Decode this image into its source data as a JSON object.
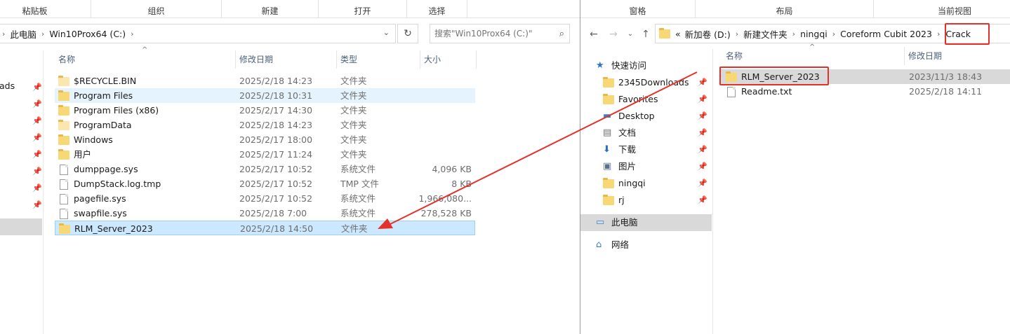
{
  "left": {
    "ribbon": [
      "粘贴板",
      "组织",
      "新建",
      "打开",
      "选择"
    ],
    "address": [
      "此电脑",
      "Win10Prox64 (C:)"
    ],
    "search_placeholder": "搜索\"Win10Prox64 (C:)\"",
    "columns": {
      "name": "名称",
      "date": "修改日期",
      "type": "类型",
      "size": "大小"
    },
    "nav_partial": "ads",
    "files": [
      {
        "name": "$RECYCLE.BIN",
        "date": "2025/2/18 14:23",
        "type": "文件夹",
        "size": "",
        "icon": "folder-pale-icon"
      },
      {
        "name": "Program Files",
        "date": "2025/2/18 10:31",
        "type": "文件夹",
        "size": "",
        "icon": "folder-icon"
      },
      {
        "name": "Program Files (x86)",
        "date": "2025/2/17 14:30",
        "type": "文件夹",
        "size": "",
        "icon": "folder-icon"
      },
      {
        "name": "ProgramData",
        "date": "2025/2/18 14:23",
        "type": "文件夹",
        "size": "",
        "icon": "folder-pale-icon"
      },
      {
        "name": "Windows",
        "date": "2025/2/17 18:00",
        "type": "文件夹",
        "size": "",
        "icon": "folder-icon"
      },
      {
        "name": "用户",
        "date": "2025/2/17 11:24",
        "type": "文件夹",
        "size": "",
        "icon": "folder-icon"
      },
      {
        "name": "dumppage.sys",
        "date": "2025/2/17 10:52",
        "type": "系统文件",
        "size": "4,096 KB",
        "icon": "file-icon"
      },
      {
        "name": "DumpStack.log.tmp",
        "date": "2025/2/17 10:52",
        "type": "TMP 文件",
        "size": "8 KB",
        "icon": "file-icon"
      },
      {
        "name": "pagefile.sys",
        "date": "2025/2/17 10:52",
        "type": "系统文件",
        "size": "1,966,080...",
        "icon": "file-icon"
      },
      {
        "name": "swapfile.sys",
        "date": "2025/2/18 7:00",
        "type": "系统文件",
        "size": "278,528 KB",
        "icon": "file-icon"
      },
      {
        "name": "RLM_Server_2023",
        "date": "2025/2/18 14:50",
        "type": "文件夹",
        "size": "",
        "icon": "folder-icon"
      }
    ]
  },
  "right": {
    "ribbon": [
      "窗格",
      "布局",
      "当前视图"
    ],
    "address": [
      "«",
      "新加卷 (D:)",
      "新建文件夹",
      "ningqi",
      "Coreform Cubit 2023",
      "Crack"
    ],
    "columns": {
      "name": "名称",
      "date": "修改日期"
    },
    "nav": [
      {
        "label": "快速访问",
        "icon": "star-icon"
      },
      {
        "label": "2345Downloads",
        "icon": "folder-icon"
      },
      {
        "label": "Favorites",
        "icon": "folder-icon"
      },
      {
        "label": "Desktop",
        "icon": "desktop-icon"
      },
      {
        "label": "文档",
        "icon": "document-icon"
      },
      {
        "label": "下载",
        "icon": "download-icon"
      },
      {
        "label": "图片",
        "icon": "picture-icon"
      },
      {
        "label": "ningqi",
        "icon": "folder-icon"
      },
      {
        "label": "rj",
        "icon": "folder-icon"
      },
      {
        "label": "此电脑",
        "icon": "computer-icon"
      },
      {
        "label": "网络",
        "icon": "network-icon"
      }
    ],
    "files": [
      {
        "name": "RLM_Server_2023",
        "date": "2023/11/3 18:43",
        "icon": "folder-icon"
      },
      {
        "name": "Readme.txt",
        "date": "2025/2/18 14:11",
        "icon": "file-icon"
      }
    ]
  },
  "colors": {
    "highlight": "#e4312b",
    "selection": "#cce8ff",
    "hover": "#e5f3ff",
    "folder": "#f8d775"
  }
}
